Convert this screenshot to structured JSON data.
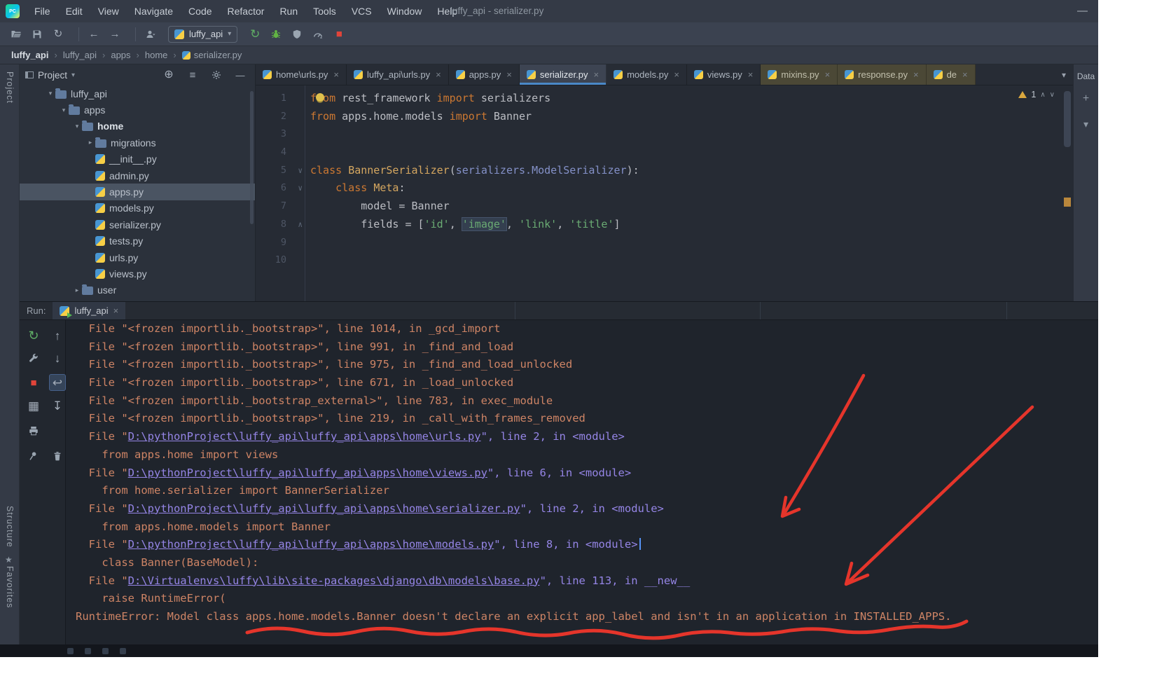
{
  "colors": {
    "annotation_red": "#e5352b",
    "console_orange": "#ce8465",
    "link_violet": "#9585e6",
    "keyword_orange": "#cc7832",
    "string_green": "#6aab73",
    "class_gold": "#d5a760",
    "inherit_violet": "#8491c8",
    "accent_blue": "#4a88c7",
    "warning_yellow": "#d9a73e",
    "run_green": "#5fad65",
    "stop_red": "#d15b52"
  },
  "titlebar": {
    "title": "luffy_api - serializer.py",
    "minimize_glyph": "—",
    "menu": [
      "File",
      "Edit",
      "View",
      "Navigate",
      "Code",
      "Refactor",
      "Run",
      "Tools",
      "VCS",
      "Window",
      "Help"
    ]
  },
  "toolbar": {
    "left_icons": [
      "open-icon",
      "save-icon",
      "sync-icon",
      "back-icon",
      "forward-icon",
      "user-icon"
    ],
    "run_config": "luffy_api",
    "run_icons": [
      "run-icon",
      "debug-icon",
      "coverage-icon",
      "profiler-icon",
      "stop-icon"
    ]
  },
  "breadcrumbs": [
    "luffy_api",
    "luffy_api",
    "apps",
    "home",
    "serializer.py"
  ],
  "left_stripe": {
    "project_label": "Project",
    "structure_label": "Structure",
    "favorites_label": "Favorites"
  },
  "right_stripe": {
    "label": "Data",
    "icons": [
      "add-icon",
      "chevron-down-icon"
    ]
  },
  "project_panel": {
    "header": "Project",
    "header_icons": [
      "locate-icon",
      "collapse-all-icon",
      "settings-icon",
      "hide-icon"
    ],
    "tree": [
      {
        "label": "luffy_api",
        "depth": 1,
        "icon": "folder",
        "chev": "open"
      },
      {
        "label": "apps",
        "depth": 2,
        "icon": "folder",
        "chev": "open"
      },
      {
        "label": "home",
        "depth": 3,
        "icon": "folder",
        "chev": "open",
        "bold": true
      },
      {
        "label": "migrations",
        "depth": 4,
        "icon": "folder",
        "chev": "closed"
      },
      {
        "label": "__init__.py",
        "depth": 4,
        "icon": "python"
      },
      {
        "label": "admin.py",
        "depth": 4,
        "icon": "python"
      },
      {
        "label": "apps.py",
        "depth": 4,
        "icon": "python",
        "selected": true
      },
      {
        "label": "models.py",
        "depth": 4,
        "icon": "python"
      },
      {
        "label": "serializer.py",
        "depth": 4,
        "icon": "python"
      },
      {
        "label": "tests.py",
        "depth": 4,
        "icon": "python"
      },
      {
        "label": "urls.py",
        "depth": 4,
        "icon": "python"
      },
      {
        "label": "views.py",
        "depth": 4,
        "icon": "python"
      },
      {
        "label": "user",
        "depth": 3,
        "icon": "folder",
        "chev": "closed"
      }
    ]
  },
  "editor": {
    "tabs": [
      {
        "label": "home\\urls.py"
      },
      {
        "label": "luffy_api\\urls.py"
      },
      {
        "label": "apps.py"
      },
      {
        "label": "serializer.py",
        "state": "active"
      },
      {
        "label": "models.py"
      },
      {
        "label": "views.py"
      },
      {
        "label": "mixins.py",
        "state": "lib"
      },
      {
        "label": "response.py",
        "state": "lib"
      },
      {
        "label": "de",
        "state": "lib"
      }
    ],
    "inspections": {
      "warning_count": "1"
    },
    "code": [
      {
        "n": "1",
        "bulb": true,
        "tokens": [
          [
            "kw",
            "from"
          ],
          [
            "pl",
            " rest_framework "
          ],
          [
            "kw",
            "import"
          ],
          [
            "pl",
            " serializers"
          ]
        ]
      },
      {
        "n": "2",
        "tokens": [
          [
            "kw",
            "from"
          ],
          [
            "pl",
            " apps.home.models "
          ],
          [
            "kw",
            "import"
          ],
          [
            "pl",
            " Banner"
          ]
        ]
      },
      {
        "n": "3",
        "tokens": []
      },
      {
        "n": "4",
        "tokens": []
      },
      {
        "n": "5",
        "fold": "v",
        "tokens": [
          [
            "kw",
            "class "
          ],
          [
            "cls",
            "BannerSerializer"
          ],
          [
            "pl",
            "("
          ],
          [
            "inh",
            "serializers.ModelSerializer"
          ],
          [
            "pl",
            "):"
          ]
        ]
      },
      {
        "n": "6",
        "fold": "v",
        "tokens": [
          [
            "pl",
            "    "
          ],
          [
            "kw",
            "class "
          ],
          [
            "cls",
            "Meta"
          ],
          [
            "pl",
            ":"
          ]
        ]
      },
      {
        "n": "7",
        "tokens": [
          [
            "pl",
            "        model = Banner"
          ]
        ]
      },
      {
        "n": "8",
        "fold": "^",
        "tokens": [
          [
            "pl",
            "        fields = ["
          ],
          [
            "str",
            "'id'"
          ],
          [
            "pl",
            ", "
          ],
          [
            "strh",
            "'image'"
          ],
          [
            "pl",
            ", "
          ],
          [
            "str",
            "'link'"
          ],
          [
            "pl",
            ", "
          ],
          [
            "str",
            "'title'"
          ],
          [
            "pl",
            "]"
          ]
        ]
      },
      {
        "n": "9",
        "tokens": []
      },
      {
        "n": "10",
        "tokens": []
      }
    ]
  },
  "run_panel": {
    "label": "Run:",
    "tab": {
      "label": "luffy_api"
    },
    "toolbar": [
      {
        "name": "rerun-icon",
        "col": 0,
        "row": 0
      },
      {
        "name": "build-icon",
        "col": 0,
        "row": 1
      },
      {
        "name": "stop-icon",
        "col": 0,
        "row": 2
      },
      {
        "name": "layout-icon",
        "col": 0,
        "row": 3
      },
      {
        "name": "print-icon",
        "col": 0,
        "row": 4
      },
      {
        "name": "pin-icon",
        "col": 0,
        "row": 5
      },
      {
        "name": "up-icon",
        "col": 1,
        "row": 0
      },
      {
        "name": "down-icon",
        "col": 1,
        "row": 1
      },
      {
        "name": "softwrap-icon",
        "col": 1,
        "row": 2,
        "selected": true
      },
      {
        "name": "scroll-end-icon",
        "col": 1,
        "row": 3
      },
      {
        "name": "clear-icon",
        "col": 1,
        "row": 5
      }
    ],
    "console": [
      {
        "segs": [
          [
            "o",
            "  File \"<frozen importlib._bootstrap>\", line 1014, in _gcd_import"
          ]
        ]
      },
      {
        "segs": [
          [
            "o",
            "  File \"<frozen importlib._bootstrap>\", line 991, in _find_and_load"
          ]
        ]
      },
      {
        "segs": [
          [
            "o",
            "  File \"<frozen importlib._bootstrap>\", line 975, in _find_and_load_unlocked"
          ]
        ]
      },
      {
        "segs": [
          [
            "o",
            "  File \"<frozen importlib._bootstrap>\", line 671, in _load_unlocked"
          ]
        ]
      },
      {
        "segs": [
          [
            "o",
            "  File \"<frozen importlib._bootstrap_external>\", line 783, in exec_module"
          ]
        ]
      },
      {
        "segs": [
          [
            "o",
            "  File \"<frozen importlib._bootstrap>\", line 219, in _call_with_frames_removed"
          ]
        ]
      },
      {
        "segs": [
          [
            "o",
            "  File \""
          ],
          [
            "l",
            "D:\\pythonProject\\luffy_api\\luffy_api\\apps\\home\\urls.py"
          ],
          [
            "v",
            "\", line 2, in <module>"
          ]
        ]
      },
      {
        "segs": [
          [
            "o",
            "    from apps.home import views"
          ]
        ]
      },
      {
        "segs": [
          [
            "o",
            "  File \""
          ],
          [
            "l",
            "D:\\pythonProject\\luffy_api\\luffy_api\\apps\\home\\views.py"
          ],
          [
            "v",
            "\", line 6, in <module>"
          ]
        ]
      },
      {
        "segs": [
          [
            "o",
            "    from home.serializer import BannerSerializer"
          ]
        ]
      },
      {
        "segs": [
          [
            "o",
            "  File \""
          ],
          [
            "l",
            "D:\\pythonProject\\luffy_api\\luffy_api\\apps\\home\\serializer.py"
          ],
          [
            "v",
            "\", line 2, in <module>"
          ]
        ]
      },
      {
        "segs": [
          [
            "o",
            "    from apps.home.models import Banner"
          ]
        ]
      },
      {
        "segs": [
          [
            "o",
            "  File \""
          ],
          [
            "l",
            "D:\\pythonProject\\luffy_api\\luffy_api\\apps\\home\\models.py"
          ],
          [
            "v",
            "\", line 8, in <module>"
          ]
        ],
        "caret": true
      },
      {
        "segs": [
          [
            "o",
            "    class Banner(BaseModel):"
          ]
        ]
      },
      {
        "segs": [
          [
            "o",
            "  File \""
          ],
          [
            "l",
            "D:\\Virtualenvs\\luffy\\lib\\site-packages\\django\\db\\models\\base.py"
          ],
          [
            "v",
            "\", line 113, in __new__"
          ]
        ]
      },
      {
        "segs": [
          [
            "o",
            "    raise RuntimeError("
          ]
        ]
      },
      {
        "segs": [
          [
            "o",
            "RuntimeError: Model class apps.home.models.Banner doesn't declare an explicit app_label and isn't in an application in INSTALLED_APPS."
          ]
        ]
      }
    ]
  },
  "icons": {
    "close": "×",
    "chevron_down": "▾",
    "star": "★"
  }
}
